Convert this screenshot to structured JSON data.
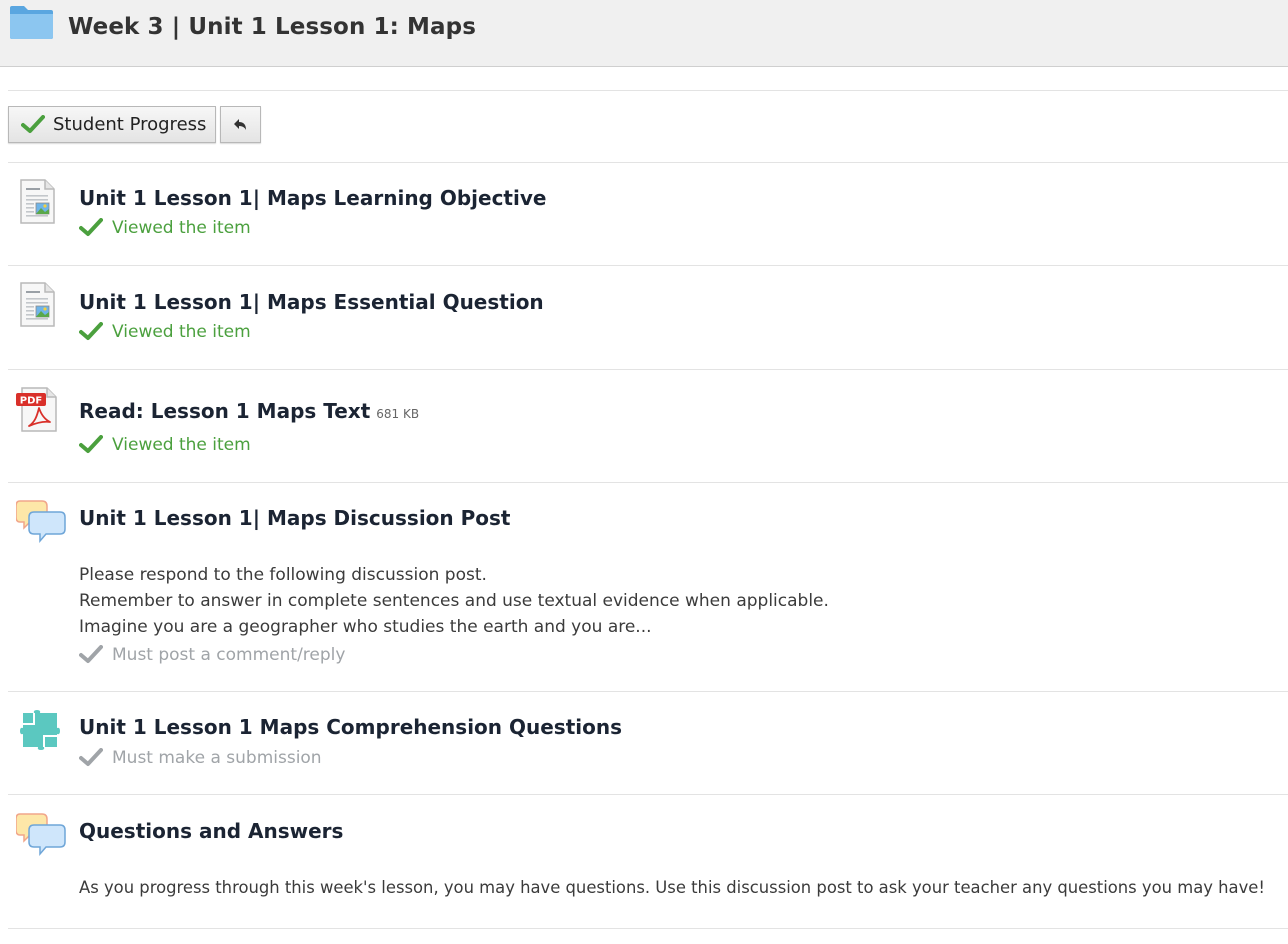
{
  "header": {
    "title": "Week 3 | Unit 1 Lesson 1: Maps"
  },
  "toolbar": {
    "progress_label": "Student Progress"
  },
  "items": [
    {
      "title": "Unit 1 Lesson 1| Maps Learning Objective",
      "icon": "document-icon",
      "status": "Viewed the item"
    },
    {
      "title": "Unit 1 Lesson 1| Maps Essential Question",
      "icon": "document-icon",
      "status": "Viewed the item"
    },
    {
      "title": "Read: Lesson 1 Maps Text",
      "size": "681 KB",
      "icon": "pdf-icon",
      "status": "Viewed the item"
    },
    {
      "title": "Unit 1 Lesson 1| Maps Discussion Post",
      "icon": "discussion-icon",
      "description": [
        "Please respond to the following discussion post.",
        "Remember to answer in complete sentences and use textual evidence when applicable.",
        "Imagine you are a geographer who studies the earth and you are..."
      ],
      "status": "Must post a comment/reply"
    },
    {
      "title": "Unit 1 Lesson 1 Maps Comprehension Questions",
      "icon": "puzzle-icon",
      "status": "Must make a submission"
    },
    {
      "title": "Questions and Answers",
      "icon": "discussion-icon",
      "description": [
        "As you progress through this week's lesson, you may have questions. Use this discussion post to ask your teacher any questions you may have!"
      ]
    }
  ],
  "colors": {
    "done": "#4ba03e",
    "todo": "#a0a4a8",
    "header_bg": "#f0f0f0"
  }
}
